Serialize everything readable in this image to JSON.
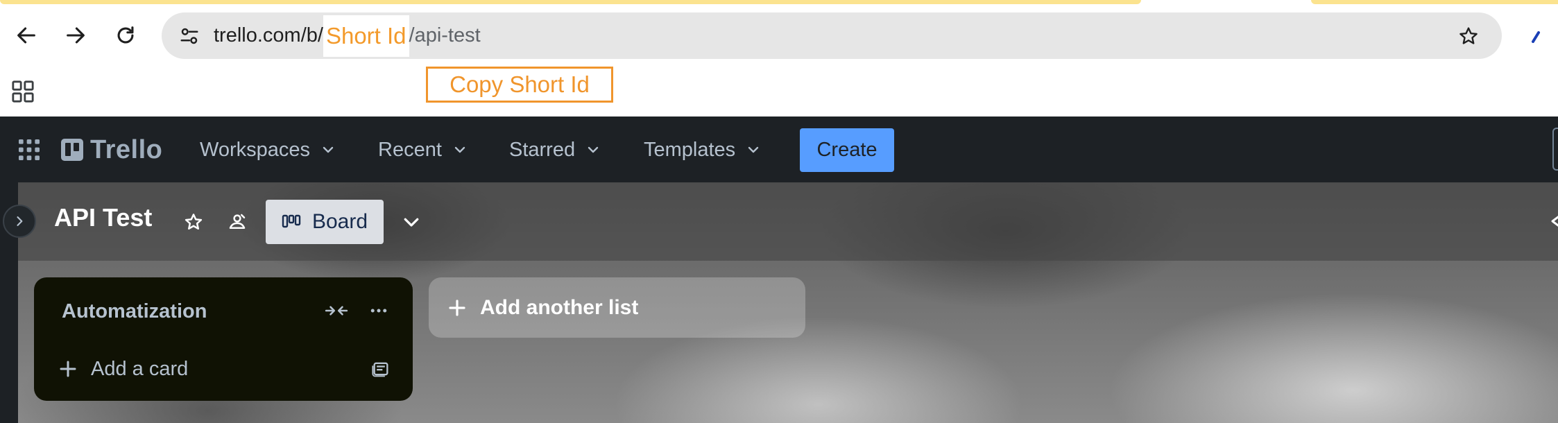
{
  "browser": {
    "url_host": "trello.com/b/",
    "url_id_highlight": "Short Id",
    "url_path": "/api-test"
  },
  "annotation": {
    "callout_label": "Copy Short Id"
  },
  "header": {
    "logo_text": "Trello",
    "menus": [
      {
        "label": "Workspaces"
      },
      {
        "label": "Recent"
      },
      {
        "label": "Starred"
      },
      {
        "label": "Templates"
      }
    ],
    "create_label": "Create"
  },
  "board": {
    "title": "API Test",
    "view_label": "Board",
    "list": {
      "title": "Automatization",
      "add_card_label": "Add a card"
    },
    "add_list_label": "Add another list"
  },
  "colors": {
    "header_bg": "#1d2125",
    "create_button": "#579dff",
    "callout_orange": "#f0952c",
    "list_bg": "#101204"
  }
}
